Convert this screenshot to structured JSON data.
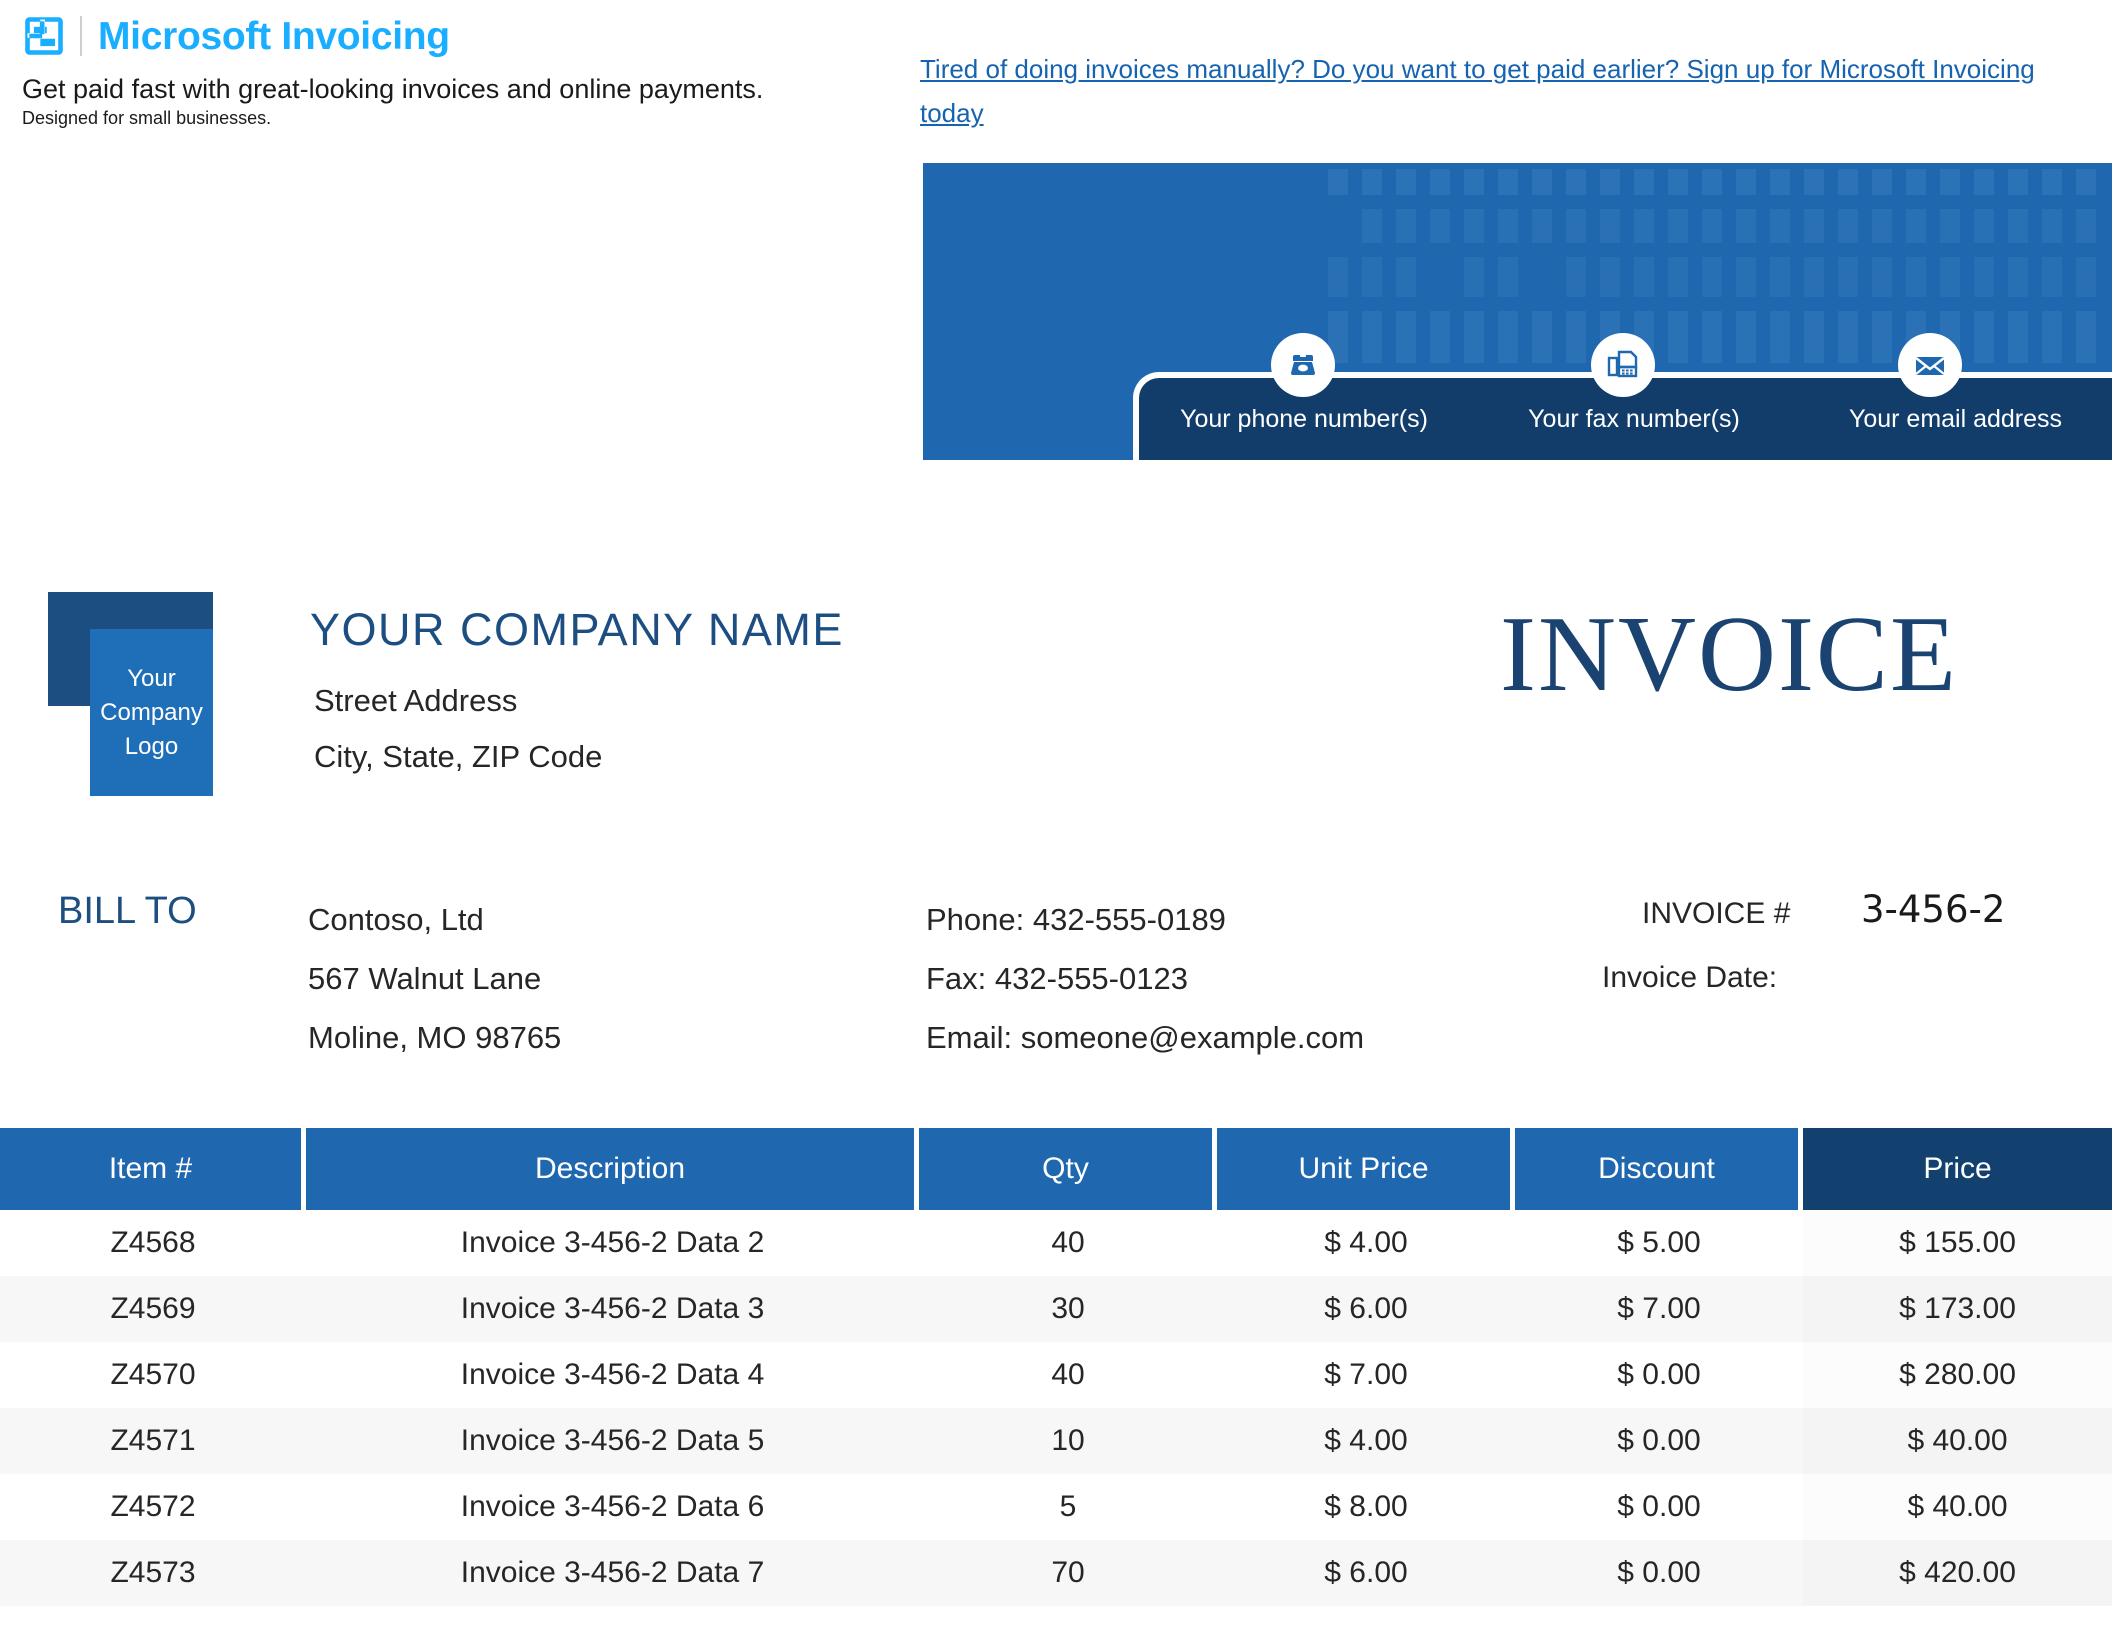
{
  "promo": {
    "brand_title": "Microsoft Invoicing",
    "tagline": "Get paid fast with great-looking invoices and online payments.",
    "subtagline": "Designed for small businesses.",
    "link_text": "Tired of doing invoices manually? Do you want to get paid earlier? Sign up for Microsoft Invoicing today ",
    "brand_color": "#19AEFF",
    "link_color": "#1663B0"
  },
  "banner": {
    "bg_color": "#1F68B0",
    "panel_color": "#123D6B",
    "contacts": [
      {
        "icon": "telephone-icon",
        "label": "Your phone number(s)"
      },
      {
        "icon": "fax-machine-icon",
        "label": "Your fax number(s)"
      },
      {
        "icon": "envelope-icon",
        "label": "Your email address"
      }
    ]
  },
  "company": {
    "logo_text_line1": "Your",
    "logo_text_line2": "Company",
    "logo_text_line3": "Logo",
    "name": "YOUR COMPANY NAME",
    "street": "Street Address",
    "city_state_zip": "City, State, ZIP Code",
    "name_color": "#1D4E82"
  },
  "document": {
    "title": "INVOICE",
    "title_color": "#1A4372"
  },
  "bill_to": {
    "label": "BILL TO",
    "lines": [
      "Contoso, Ltd",
      "567 Walnut Lane",
      "Moline, MO 98765"
    ]
  },
  "contact": {
    "lines": [
      "Phone: 432-555-0189",
      "Fax: 432-555-0123",
      "Email: someone@example.com"
    ]
  },
  "meta": {
    "invoice_number_label": "INVOICE #",
    "invoice_number": "3-456-2",
    "invoice_date_label": "Invoice Date:",
    "invoice_date": ""
  },
  "table": {
    "header_color": "#1F68B0",
    "price_header_color": "#12406F",
    "columns": [
      "Item #",
      "Description",
      "Qty",
      "Unit Price",
      "Discount",
      "Price"
    ],
    "rows": [
      {
        "item": "Z4568",
        "description": "Invoice 3-456-2 Data 2",
        "qty": "40",
        "unit_price": "$ 4.00",
        "discount": "$ 5.00",
        "price": "$ 155.00"
      },
      {
        "item": "Z4569",
        "description": "Invoice 3-456-2 Data 3",
        "qty": "30",
        "unit_price": "$ 6.00",
        "discount": "$ 7.00",
        "price": "$ 173.00"
      },
      {
        "item": "Z4570",
        "description": "Invoice 3-456-2 Data 4",
        "qty": "40",
        "unit_price": "$ 7.00",
        "discount": "$ 0.00",
        "price": "$ 280.00"
      },
      {
        "item": "Z4571",
        "description": "Invoice 3-456-2 Data 5",
        "qty": "10",
        "unit_price": "$ 4.00",
        "discount": "$ 0.00",
        "price": "$ 40.00"
      },
      {
        "item": "Z4572",
        "description": "Invoice 3-456-2 Data 6",
        "qty": "5",
        "unit_price": "$ 8.00",
        "discount": "$ 0.00",
        "price": "$ 40.00"
      },
      {
        "item": "Z4573",
        "description": "Invoice 3-456-2 Data 7",
        "qty": "70",
        "unit_price": "$ 6.00",
        "discount": "$ 0.00",
        "price": "$ 420.00"
      }
    ]
  }
}
